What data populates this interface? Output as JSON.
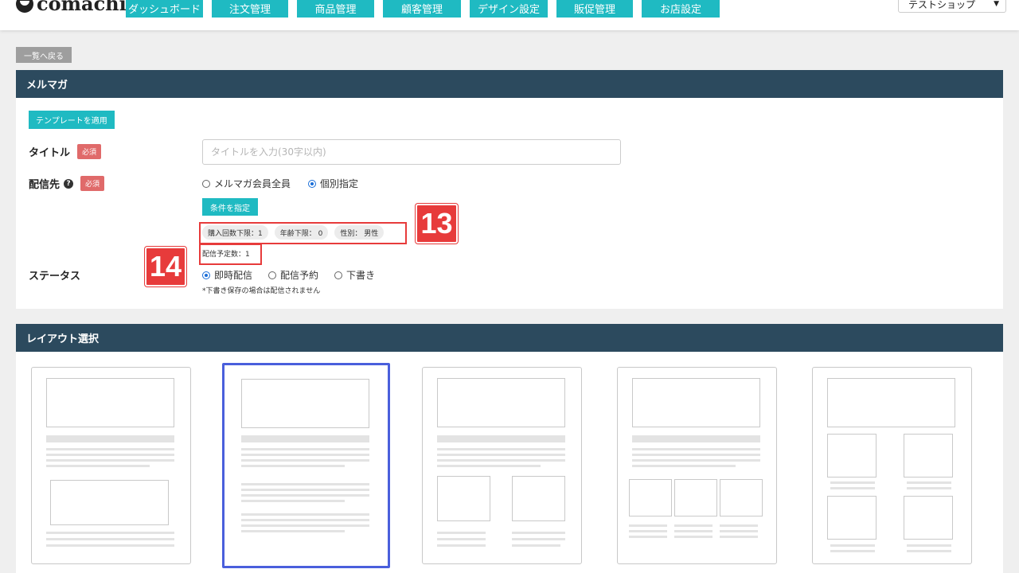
{
  "header": {
    "logo": "comachi",
    "nav": [
      "ダッシュボード",
      "注文管理",
      "商品管理",
      "顧客管理",
      "デザイン設定",
      "販促管理",
      "お店設定"
    ],
    "shop_select": "テストショップ"
  },
  "back_button": "一覧へ戻る",
  "mailmag": {
    "heading": "メルマガ",
    "template_button": "テンプレートを適用",
    "required": "必須",
    "title_label": "タイトル",
    "title_placeholder": "タイトルを入力(30字以内)",
    "dest_label": "配信先",
    "dest_options": [
      {
        "label": "メルマガ会員全員",
        "checked": false
      },
      {
        "label": "個別指定",
        "checked": true
      }
    ],
    "condition_button": "条件を指定",
    "conditions": [
      "購入回数下限：1",
      "年齢下限： 0",
      "性別： 男性"
    ],
    "count": "配信予定数：1",
    "status_label": "ステータス",
    "status_options": [
      {
        "label": "即時配信",
        "checked": true
      },
      {
        "label": "配信予約",
        "checked": false
      },
      {
        "label": "下書き",
        "checked": false
      }
    ],
    "status_note": "*下書き保存の場合は配信されません"
  },
  "annotations": [
    "13",
    "14"
  ],
  "layout": {
    "heading": "レイアウト選択",
    "selected_index": 1
  }
}
